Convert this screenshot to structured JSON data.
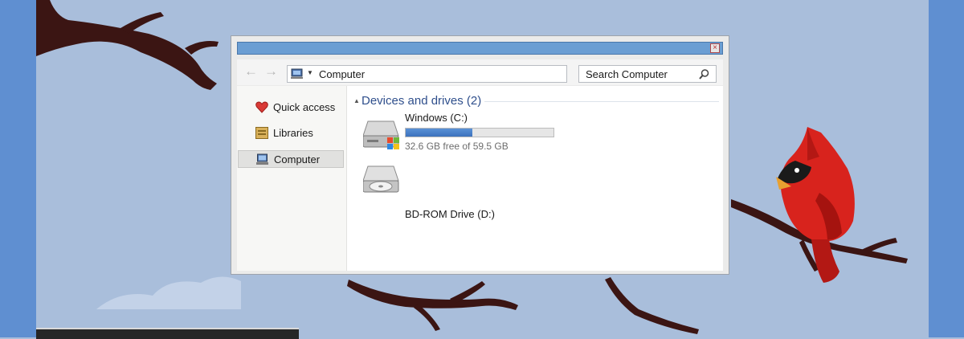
{
  "window": {
    "address": {
      "location": "Computer"
    },
    "search": {
      "placeholder": "Search Computer"
    }
  },
  "nav_pane": {
    "items": [
      {
        "label": "Quick access",
        "icon": "heart-icon",
        "selected": false
      },
      {
        "label": "Libraries",
        "icon": "library-icon",
        "selected": false
      },
      {
        "label": "Computer",
        "icon": "computer-icon",
        "selected": true
      }
    ]
  },
  "content": {
    "group_header": "Devices and drives (2)",
    "drives": [
      {
        "name": "Windows (C:)",
        "free_text": "32.6 GB free of 59.5 GB",
        "used_fraction": 0.452,
        "icon": "hard-drive-windows-icon"
      },
      {
        "name": "BD-ROM Drive (D:)",
        "icon": "optical-drive-icon"
      }
    ]
  },
  "colors": {
    "titlebar": "#6b9ed3",
    "progress": "#3c72bd",
    "group_header": "#2f4f8c",
    "wallpaper_sky": "#a9bedb",
    "cardinal_red": "#d8231d"
  }
}
